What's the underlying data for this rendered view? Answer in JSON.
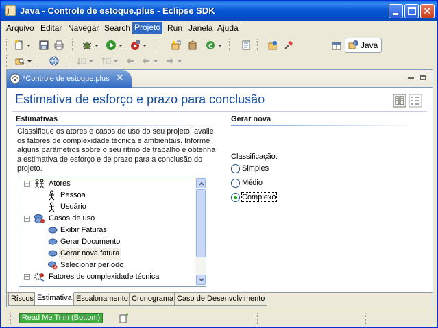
{
  "window": {
    "title": "Java - Controle de estoque.plus - Eclipse SDK"
  },
  "menubar": {
    "items": [
      {
        "label": "Arquivo"
      },
      {
        "label": "Editar"
      },
      {
        "label": "Navegar"
      },
      {
        "label": "Search"
      },
      {
        "label": "Projeto"
      },
      {
        "label": "Run"
      },
      {
        "label": "Janela"
      },
      {
        "label": "Ajuda"
      }
    ],
    "active_index": 4
  },
  "perspective": {
    "label": "Java",
    "icon": "java-perspective-icon"
  },
  "editor": {
    "tab_label": "*Controle de estoque.plus",
    "tab_close": "✕",
    "form_title": "Estimativa de esforço e prazo para conclusão",
    "left_section": {
      "title": "Estimativas",
      "description": "Classifique os atores e casos de uso do seu projeto, avalie os fatores de complexidade técnica e ambientais. Informe alguns parâmetros sobre o seu ritmo de trabalho e obtenha a estimativa de esforço e de prazo para a conclusão do projeto.",
      "tree": [
        {
          "label": "Atores",
          "icon": "actors-icon",
          "level": 0,
          "expander": "−"
        },
        {
          "label": "Pessoa",
          "icon": "actor-icon",
          "level": 1
        },
        {
          "label": "Usuário",
          "icon": "actor-icon",
          "level": 1
        },
        {
          "label": "Casos de uso",
          "icon": "use-cases-icon",
          "level": 0,
          "expander": "−"
        },
        {
          "label": "Exibir Faturas",
          "icon": "use-case-icon",
          "level": 1
        },
        {
          "label": "Gerar Documento",
          "icon": "use-case-icon",
          "level": 1
        },
        {
          "label": "Gerar nova fatura",
          "icon": "use-case-icon",
          "level": 1,
          "selected": true
        },
        {
          "label": "Selecionar período",
          "icon": "use-case-unknown-icon",
          "level": 1
        },
        {
          "label": "Fatores de complexidade técnica",
          "icon": "technical-factors-icon",
          "level": 0,
          "expander": "+"
        }
      ]
    },
    "right_section": {
      "title": "Gerar nova",
      "classification_label": "Classificação:",
      "options": [
        {
          "label": "Simples",
          "selected": false
        },
        {
          "label": "Médio",
          "selected": false
        },
        {
          "label": "Complexo",
          "selected": true
        }
      ]
    },
    "page_tabs": [
      {
        "label": "Riscos",
        "active": false
      },
      {
        "label": "Estimativa",
        "active": true
      },
      {
        "label": "Escalonamento",
        "active": false
      },
      {
        "label": "Cronograma",
        "active": false
      },
      {
        "label": "Caso de Desenvolvimento",
        "active": false
      }
    ]
  },
  "statusbar": {
    "trim_label": "Read Me Trim (Bottom)"
  },
  "colors": {
    "titlebar": "#0757d6",
    "form_title": "#154c9c",
    "active_tab": "#316ac5",
    "trim": "#3fac3f"
  }
}
